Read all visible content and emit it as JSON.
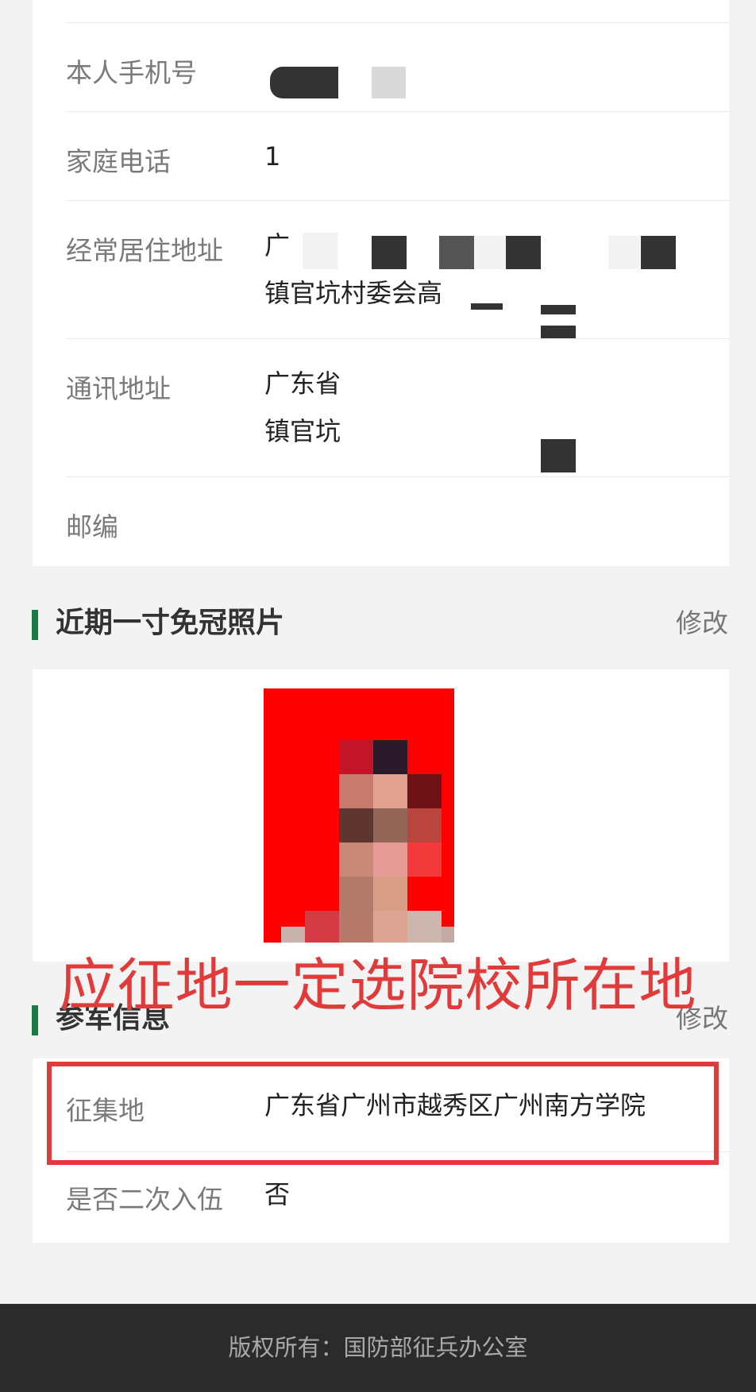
{
  "contact": {
    "rows": [
      {
        "label": "本人手机号",
        "value": ""
      },
      {
        "label": "家庭电话",
        "value": "1"
      },
      {
        "label": "经常居住地址",
        "value_line1": "广",
        "value_line2": "镇官坑村委会高"
      },
      {
        "label": "通讯地址",
        "value_line1": "广东省",
        "value_line2": "镇官坑"
      },
      {
        "label": "邮编",
        "value": ""
      }
    ]
  },
  "photo_section": {
    "title": "近期一寸免冠照片",
    "edit_label": "修改",
    "background_color": "#ff0000"
  },
  "annotation": {
    "text": "应征地一定选院校所在地",
    "color": "#e03a3a"
  },
  "military_section": {
    "title": "参军信息",
    "edit_label": "修改",
    "rows": [
      {
        "label": "征集地",
        "value": "广东省广州市越秀区广州南方学院"
      },
      {
        "label": "是否二次入伍",
        "value": "否"
      }
    ]
  },
  "footer": {
    "copyright": "版权所有：国防部征兵办公室"
  },
  "colors": {
    "accent_bar": "#1a7a44",
    "highlight": "#e03a3a",
    "footer_bg": "#2b2b2b"
  }
}
